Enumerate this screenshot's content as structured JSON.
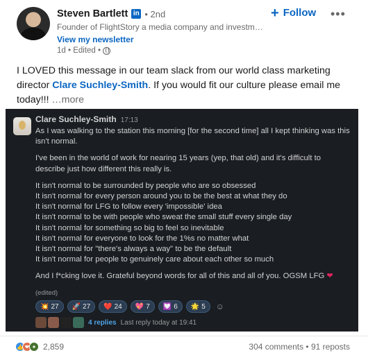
{
  "author": {
    "name": "Steven Bartlett",
    "badge": "in",
    "degree": "• 2nd",
    "headline": "Founder of FlightStory a media company and investme…",
    "newsletter": "View my newsletter",
    "posted": "1d • Edited •"
  },
  "actions": {
    "follow_label": "Follow",
    "more": "•••"
  },
  "post": {
    "text_before": "I LOVED this message in our team slack from our world class marketing director ",
    "mention": "Clare Suchley-Smith",
    "text_after": ". If you would fit our culture please email me today!!! ",
    "see_more": "…more"
  },
  "slack": {
    "name": "Clare Suchley-Smith",
    "time": "17:13",
    "p1": "As I was walking to the station this morning [for the second time] all I kept thinking was this isn't normal.",
    "p2": "I've been in the world of work for nearing 15 years (yep, that old) and it's difficult to describe just how different this really is.",
    "lines": [
      "It isn't normal to be surrounded by people who are so obsessed",
      "It isn't normal for every person around you to be the best at what they do",
      "It isn't normal for LFG to follow every 'impossible' idea",
      "It isn't normal to be with people who sweat the small stuff every single day",
      "It isn't normal for something so big to feel so inevitable",
      "It isn't normal for everyone to look for the 1%s no matter what",
      "It isn't normal for \"there's always a way\" to be the default",
      "It isn't normal for people to genuinely care about each other so much"
    ],
    "p3": "And I f*cking love it. Grateful beyond words for all of this and all of you. OGSM LFG",
    "p3_emoji": "❤",
    "edited": "(edited)",
    "reactions": [
      {
        "emoji": "💥",
        "count": "27"
      },
      {
        "emoji": "🚀",
        "count": "27"
      },
      {
        "emoji": "❤️",
        "count": "24"
      },
      {
        "emoji": "💖",
        "count": "7"
      },
      {
        "emoji": "💟",
        "count": "6"
      },
      {
        "emoji": "🌟",
        "count": "5"
      }
    ],
    "add_reaction": "☺",
    "replies": "4 replies",
    "last_reply": "Last reply today at 19:41"
  },
  "social": {
    "reactions_count": "2,859",
    "comments": "304 comments • 91 reposts"
  },
  "colors": {
    "linkedin_blue": "#0a66c2",
    "slack_bg": "#1a1d21",
    "slack_text": "#d1d2d3"
  }
}
